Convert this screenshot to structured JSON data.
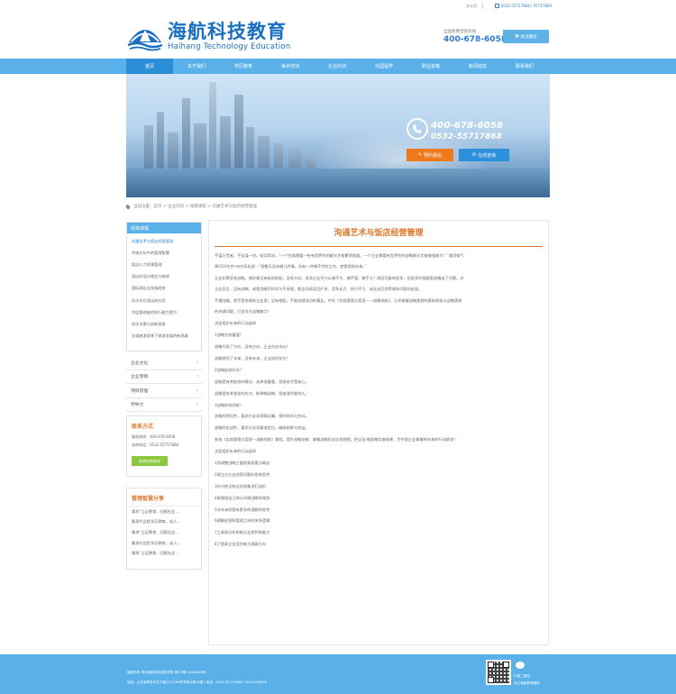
{
  "topbar": {
    "link1": "分公司",
    "phone": "0532-55717868 | 55717869"
  },
  "header": {
    "logo_cn": "海航科技教育",
    "logo_en": "Haihang Technology Education",
    "hotline_label": "全国免费咨询热线",
    "hotline_number": "400-678-6058",
    "wechat_button": "关注微信"
  },
  "nav": {
    "items": [
      "首页",
      "关于我们",
      "学历教育",
      "美术培训",
      "企业内训",
      "出国留学",
      "职业资格",
      "新闻动态",
      "联系我们"
    ]
  },
  "banner": {
    "phone1": "400-678-6058",
    "phone2": "0532-55717868",
    "signup_button": "预约报名",
    "consult_button": "在线咨询"
  },
  "breadcrumb": "当前位置：首页 > 企业内训 > 经典课程 > 沟通艺术与饭店经营管理",
  "sidebar": {
    "heading": "经典课程",
    "items": [
      "沟通艺术与饭店经营管理",
      "传统文化中的管理智慧",
      "饭店人力资源管理",
      "酒店的设计理念与装修",
      "国际酒店业发展趋势",
      "风水学在酒店的应用",
      "中层管理者的执行能力提升",
      "科学决策与创新思维",
      "全域旅游背景下旅游发展的新思路"
    ],
    "categories": [
      "企业文化",
      "企业营销",
      "项目管理",
      "领导力"
    ],
    "contact_title": "联系方式",
    "contact_lines": [
      "服务热线：400-678-6058",
      "咨询电话：0532-55717868"
    ],
    "online_button": "咨询在线老师",
    "share_title": "管理智慧分享",
    "share_items": [
      "秉承“立足教育、回报社会...",
      "集现代远程学历教育，成人...",
      "秉承“立足教育、回报社会...",
      "集现代远程学历教育，成人...",
      "秉承“立足教育、回报社会..."
    ]
  },
  "article": {
    "title": "沟通艺术与饭店经营管理",
    "paragraphs": [
      "不谋万世者，不足谋一时。俗话常说，“一个民族需要一些有世界性的眼光才能繁荣昌盛，一个企业需要有世界性的战略眼光才能做强做大！”通用电气",
      "原CEO杰克•韦尔奇也说：“我整天没有做几件事，但有一件做不完的工作，就是规划未来。”",
      "企业如果没有战略，就好像没有航的轮船，没有方向。很多企业为什么做不大、做不强、做不久？原因可能有很多，但很多时候都是战略出了问题。对",
      "企业而言，没有战略，或是战略不科学与不合理，都会导致盲目扩张、竞争无力、执行不力、成长无后劲等诸多问题的出现。",
      "不懂战略，就不是合格的企业家；没有眼距，不能成就成功的事业。中旺《实效管理方案班——战略领航》，让你掌握战略规划的基本框架与战略落地",
      "的关键问题，打造非凡战略魅力！",
      "决定组织未来的行动选择",
      "1战略为何重要？",
      "战略代表了方向，没有方向，企业何去何从？",
      "战略规划了未来，没有未来，企业因何存在？",
      "2战略因何存在？",
      "战略是有关取舍的情况，选择很重要，但放弃才是核心。",
      "战略是有关变化的应对，能弹缩战略，但变通才能持久。",
      "3战略如何领航？",
      "战略的预见性，要求它必须洞察远瞩，预判时间与空间。",
      "战略的实战性，要求它必须精准定位，确保结果与效益。",
      "参加《实效管理方案班—战略领航》课程，提升战略技能：掌握战略形成全线地图，把记战 略战略实施效果，为中国企业掌握明未来的行动纲领！",
      "决定组织未来的行动选择",
      "1抓调整战略主要框架和要点概念",
      "2建立对企业经营问题的系统思考",
      "3针对热点和过时现象进行剖析",
      "4能够组自己的公司做战略的规划",
      "5对未来经营有更多的理解和思考",
      "6理解经营和管理之间的关系逻辑",
      "7工具和分析帮助企业找到突破点",
      "8了提高企业竞争能力满意方向"
    ]
  },
  "footer": {
    "line1": "版权所有  青岛海航科技信息学校  鲁ICP备13004468号",
    "line2": "地址：山东省青岛市辽宁路247-269号中联大厦26楼  |  电话：0532-55717868 / 400-6786058",
    "qr_line1": "扫描二维码",
    "qr_line2": "关注海航教育微信"
  }
}
